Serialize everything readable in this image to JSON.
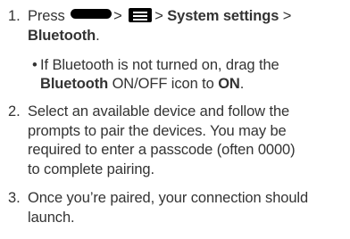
{
  "steps": [
    {
      "number": "1.",
      "line1_press": "Press",
      "sep1": ">",
      "sep2": ">",
      "line1_menu_path": "System settings",
      "sep3": ">",
      "line2_target": "Bluetooth",
      "line2_period": ".",
      "icons": [
        "home-key-icon",
        "menu-key-icon"
      ],
      "sub_bullet": {
        "symbol": "•",
        "line1": "If Bluetooth is not turned on, drag the",
        "line2_bold": "Bluetooth",
        "line2_mid": "ON/OFF icon to",
        "line2_bold2": "ON",
        "line2_end": "."
      }
    },
    {
      "number": "2.",
      "lines": [
        "Select an available device and follow the",
        "prompts to pair the devices. You may be",
        "required to enter a passcode (often 0000)",
        "to complete pairing."
      ]
    },
    {
      "number": "3.",
      "lines": [
        "Once you’re paired, your connection should",
        "launch."
      ]
    }
  ]
}
